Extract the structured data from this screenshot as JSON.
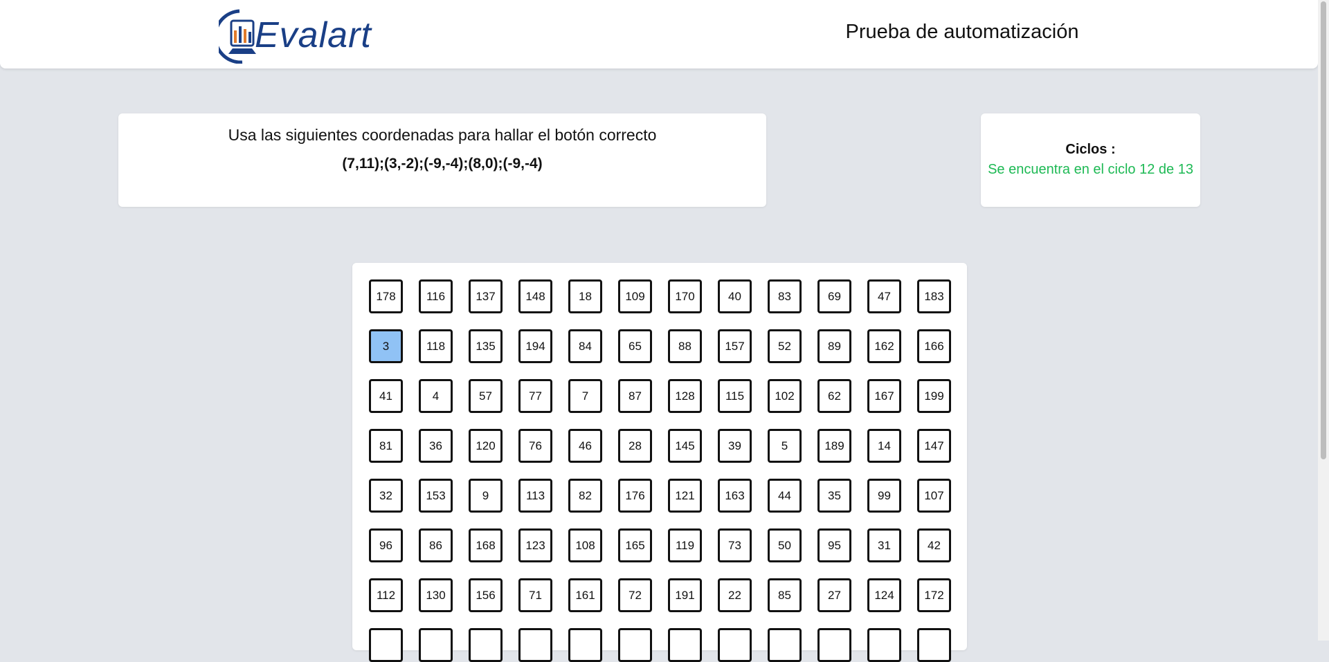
{
  "header": {
    "logo_text": "Evalart",
    "heading": "Prueba de automatización"
  },
  "instructions": {
    "title": "Usa las siguientes coordenadas para hallar el botón correcto",
    "coordinates": "(7,11);(3,-2);(-9,-4);(8,0);(-9,-4)"
  },
  "cycles": {
    "label": "Ciclos :",
    "status": "Se encuentra en el ciclo 12 de 13",
    "status_color": "#1db954"
  },
  "grid": {
    "selected_value": "3",
    "selected_color": "#90c2f5",
    "rows": [
      [
        "178",
        "116",
        "137",
        "148",
        "18",
        "109",
        "170",
        "40",
        "83",
        "69",
        "47",
        "183"
      ],
      [
        "3",
        "118",
        "135",
        "194",
        "84",
        "65",
        "88",
        "157",
        "52",
        "89",
        "162",
        "166"
      ],
      [
        "41",
        "4",
        "57",
        "77",
        "7",
        "87",
        "128",
        "115",
        "102",
        "62",
        "167",
        "199"
      ],
      [
        "81",
        "36",
        "120",
        "76",
        "46",
        "28",
        "145",
        "39",
        "5",
        "189",
        "14",
        "147"
      ],
      [
        "32",
        "153",
        "9",
        "113",
        "82",
        "176",
        "121",
        "163",
        "44",
        "35",
        "99",
        "107"
      ],
      [
        "96",
        "86",
        "168",
        "123",
        "108",
        "165",
        "119",
        "73",
        "50",
        "95",
        "31",
        "42"
      ],
      [
        "112",
        "130",
        "156",
        "71",
        "161",
        "72",
        "191",
        "22",
        "85",
        "27",
        "124",
        "172"
      ],
      [
        "",
        "",
        "",
        "",
        "",
        "",
        "",
        "",
        "",
        "",
        "",
        ""
      ]
    ]
  }
}
